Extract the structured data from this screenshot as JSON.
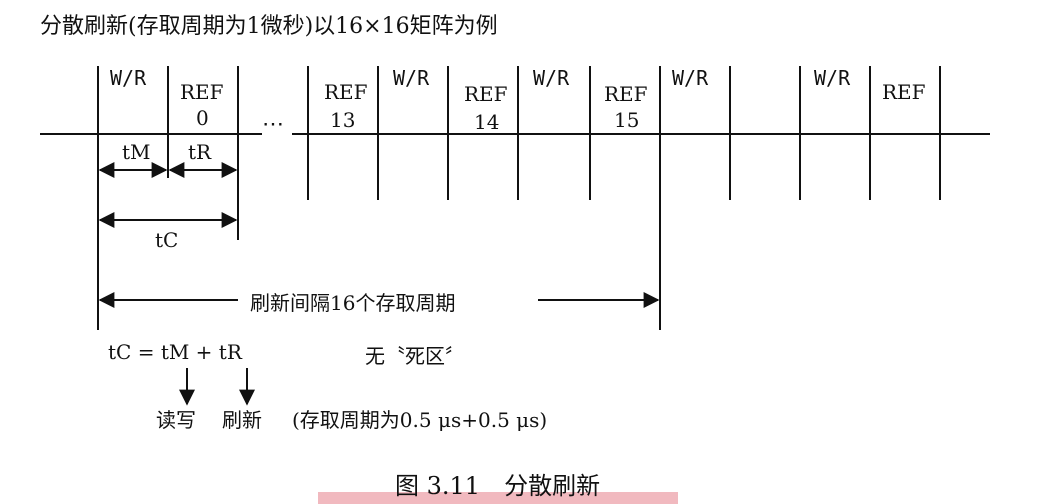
{
  "diagram": {
    "title": "分散刷新(存取周期为1微秒)以16×16矩阵为例",
    "slots": {
      "wr1": "W/R",
      "ref0_a": "REF",
      "ref0_b": "0",
      "dots": "⋯",
      "ref13_a": "REF",
      "ref13_b": "13",
      "wr2": "W/R",
      "ref14_a": "REF",
      "ref14_b": "14",
      "wr3": "W/R",
      "ref15_a": "REF",
      "ref15_b": "15",
      "wr4": "W/R",
      "wr5": "W/R",
      "ref_last": "REF"
    },
    "t_m": "tM",
    "t_r": "tR",
    "t_c": "tC",
    "interval_label": "刷新间隔16个存取周期",
    "formula": "tC = tM + tR",
    "no_dead_zone": "无〝死区〞",
    "rw_label": "读写",
    "refresh_label": "刷新",
    "cycle_note": "(存取周期为0.5 μs+0.5 μs)",
    "caption": "图 3.11　分散刷新"
  }
}
